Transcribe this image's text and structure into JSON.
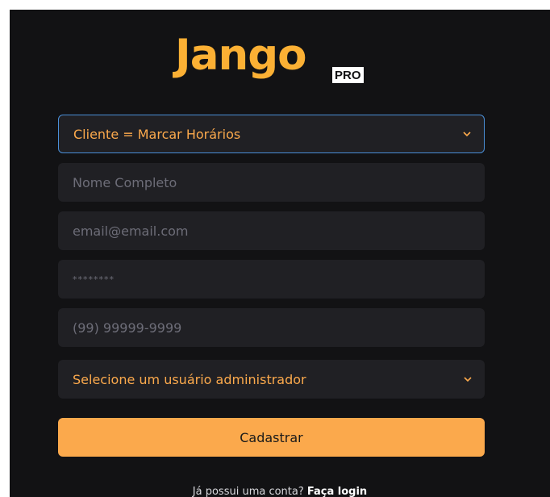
{
  "logo": {
    "text": "Jango",
    "badge": "PRO"
  },
  "form": {
    "role_select": {
      "value": "Cliente = Marcar Horários"
    },
    "name_field": {
      "placeholder": "Nome Completo"
    },
    "email_field": {
      "placeholder": "email@email.com"
    },
    "password_field": {
      "placeholder": "********"
    },
    "phone_field": {
      "placeholder": "(99) 99999-9999"
    },
    "admin_select": {
      "value": "Selecione um usuário administrador"
    },
    "submit_label": "Cadastrar"
  },
  "footer": {
    "prompt": "Já possui uma conta? ",
    "link": "Faça login"
  },
  "colors": {
    "background": "#121214",
    "field": "#202024",
    "accent": "#fba94c",
    "logo": "#fbb034",
    "focus_border": "#4a8fd8",
    "placeholder": "#6d6d78"
  }
}
